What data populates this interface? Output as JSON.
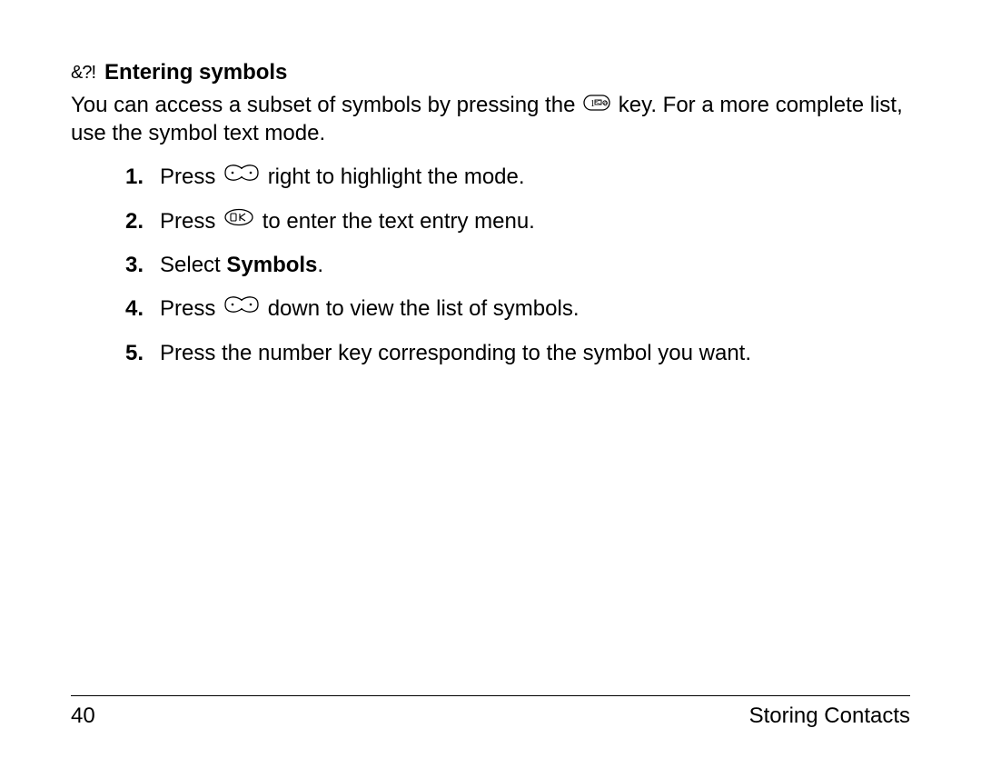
{
  "heading": {
    "icon_text": "&?!",
    "title": "Entering symbols"
  },
  "intro": {
    "part1": "You can access a subset of symbols by pressing the ",
    "part2": " key. For a more complete list, use the symbol text mode."
  },
  "steps": [
    {
      "prefix": "Press ",
      "icon": "dpad",
      "suffix": " right to highlight the mode."
    },
    {
      "prefix": "Press ",
      "icon": "ok",
      "suffix": " to enter the text entry menu."
    },
    {
      "prefix": "Select ",
      "bold": "Symbols",
      "suffix": "."
    },
    {
      "prefix": "Press ",
      "icon": "dpad",
      "suffix": " down to view the list of symbols."
    },
    {
      "prefix": "Press the number key corresponding to the symbol you want."
    }
  ],
  "footer": {
    "page_number": "40",
    "section": "Storing Contacts"
  }
}
